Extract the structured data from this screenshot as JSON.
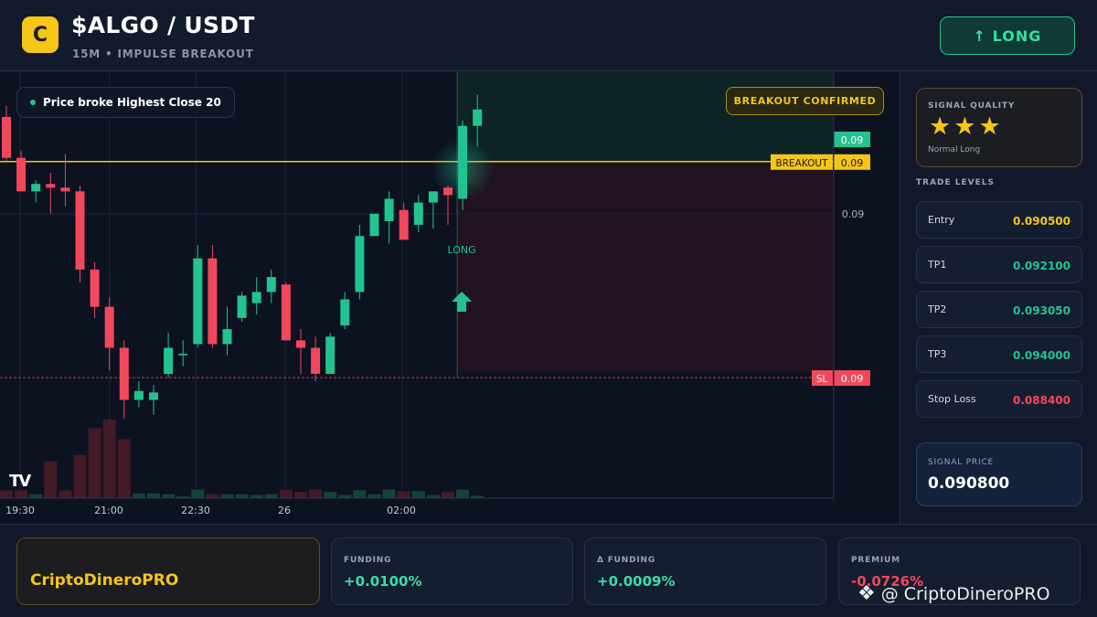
{
  "header": {
    "logo_letter": "C",
    "pair": "$ALGO / USDT",
    "subtitle": "15M • IMPULSE BREAKOUT",
    "signal_button": "↑ LONG"
  },
  "chart": {
    "pill_text": "Price broke Highest Close 20",
    "badge": "BREAKOUT CONFIRMED",
    "signal_label": "LONG",
    "tv_logo": "TV",
    "price_labels": {
      "current": "0.09",
      "breakout_name": "BREAKOUT",
      "breakout_value": "0.09",
      "axis": "0.09",
      "sl_name": "SL",
      "sl_value": "0.09"
    },
    "time_labels": [
      "19:30",
      "21:00",
      "22:30",
      "26",
      "02:00"
    ],
    "colors": {
      "up": "#23c38f",
      "down": "#f2485b",
      "breakout": "#f5c518"
    }
  },
  "chart_data": {
    "type": "candlestick",
    "x": [
      "19:30",
      "21:00",
      "22:30",
      "26",
      "02:00"
    ],
    "candles": [
      {
        "o": 0.0919,
        "h": 0.09205,
        "l": 0.0913,
        "c": 0.09135
      },
      {
        "o": 0.09135,
        "h": 0.09145,
        "l": 0.0909,
        "c": 0.0909
      },
      {
        "o": 0.0909,
        "h": 0.09105,
        "l": 0.09075,
        "c": 0.091
      },
      {
        "o": 0.091,
        "h": 0.09115,
        "l": 0.0906,
        "c": 0.09095
      },
      {
        "o": 0.09095,
        "h": 0.0914,
        "l": 0.0907,
        "c": 0.0909
      },
      {
        "o": 0.0909,
        "h": 0.09098,
        "l": 0.08968,
        "c": 0.08985
      },
      {
        "o": 0.08985,
        "h": 0.08995,
        "l": 0.0892,
        "c": 0.08935
      },
      {
        "o": 0.08935,
        "h": 0.08948,
        "l": 0.0885,
        "c": 0.0888
      },
      {
        "o": 0.0888,
        "h": 0.0889,
        "l": 0.08785,
        "c": 0.0881
      },
      {
        "o": 0.0881,
        "h": 0.08835,
        "l": 0.088,
        "c": 0.08822
      },
      {
        "o": 0.0881,
        "h": 0.0883,
        "l": 0.0879,
        "c": 0.0882
      },
      {
        "o": 0.08845,
        "h": 0.089,
        "l": 0.0884,
        "c": 0.0888
      },
      {
        "o": 0.0887,
        "h": 0.0889,
        "l": 0.08855,
        "c": 0.08872
      },
      {
        "o": 0.08885,
        "h": 0.09018,
        "l": 0.0888,
        "c": 0.09
      },
      {
        "o": 0.09,
        "h": 0.09018,
        "l": 0.0888,
        "c": 0.08885
      },
      {
        "o": 0.08885,
        "h": 0.08935,
        "l": 0.0887,
        "c": 0.08905
      },
      {
        "o": 0.0892,
        "h": 0.08955,
        "l": 0.08915,
        "c": 0.0895
      },
      {
        "o": 0.0894,
        "h": 0.08975,
        "l": 0.08925,
        "c": 0.08955
      },
      {
        "o": 0.08955,
        "h": 0.08985,
        "l": 0.0894,
        "c": 0.08975
      },
      {
        "o": 0.08965,
        "h": 0.08968,
        "l": 0.0889,
        "c": 0.0889
      },
      {
        "o": 0.0889,
        "h": 0.08905,
        "l": 0.08845,
        "c": 0.0888
      },
      {
        "o": 0.0888,
        "h": 0.08895,
        "l": 0.08835,
        "c": 0.08845
      },
      {
        "o": 0.08845,
        "h": 0.089,
        "l": 0.08845,
        "c": 0.08895
      },
      {
        "o": 0.0891,
        "h": 0.08955,
        "l": 0.08905,
        "c": 0.08945
      },
      {
        "o": 0.08955,
        "h": 0.09045,
        "l": 0.08945,
        "c": 0.0903
      },
      {
        "o": 0.0903,
        "h": 0.0906,
        "l": 0.0903,
        "c": 0.0906
      },
      {
        "o": 0.0905,
        "h": 0.0909,
        "l": 0.0902,
        "c": 0.0908
      },
      {
        "o": 0.09065,
        "h": 0.09075,
        "l": 0.09025,
        "c": 0.09025
      },
      {
        "o": 0.09045,
        "h": 0.09085,
        "l": 0.09035,
        "c": 0.09075
      },
      {
        "o": 0.09075,
        "h": 0.0909,
        "l": 0.0904,
        "c": 0.0909
      },
      {
        "o": 0.09095,
        "h": 0.09098,
        "l": 0.09045,
        "c": 0.09085
      },
      {
        "o": 0.0908,
        "h": 0.09185,
        "l": 0.09065,
        "c": 0.09178
      },
      {
        "o": 0.09178,
        "h": 0.0922,
        "l": 0.0915,
        "c": 0.092
      }
    ],
    "volume": [
      0.1,
      0.1,
      0.05,
      0.47,
      0.1,
      0.55,
      0.89,
      1.0,
      0.75,
      0.06,
      0.06,
      0.05,
      0.02,
      0.11,
      0.05,
      0.05,
      0.05,
      0.04,
      0.05,
      0.11,
      0.08,
      0.11,
      0.08,
      0.04,
      0.1,
      0.05,
      0.11,
      0.09,
      0.09,
      0.04,
      0.08,
      0.11,
      0.03
    ],
    "levels": {
      "breakout": 0.0913,
      "entry": 0.0905,
      "stop_loss": 0.0884
    },
    "signal_candle_index": 31,
    "ylim": [
      0.0871,
      0.0925
    ],
    "grid": true
  },
  "panel": {
    "quality_label": "SIGNAL QUALITY",
    "stars": "★★★",
    "quality_sub": "Normal Long",
    "trade_levels_title": "TRADE LEVELS",
    "levels": [
      {
        "name": "Entry",
        "value": "0.090500",
        "color": "#f5c518"
      },
      {
        "name": "TP1",
        "value": "0.092100",
        "color": "#23c38f"
      },
      {
        "name": "TP2",
        "value": "0.093050",
        "color": "#23c38f"
      },
      {
        "name": "TP3",
        "value": "0.094000",
        "color": "#23c38f"
      },
      {
        "name": "Stop Loss",
        "value": "0.088400",
        "color": "#f2485b"
      }
    ],
    "signal_price_label": "SIGNAL PRICE",
    "signal_price": "0.090800"
  },
  "footer": {
    "brand": "CriptoDineroPRO",
    "stats": [
      {
        "label": "FUNDING",
        "value": "+0.0100%",
        "color": "#35e0a5"
      },
      {
        "label": "Δ FUNDING",
        "value": "+0.0009%",
        "color": "#35e0a5"
      },
      {
        "label": "PREMIUM",
        "value": "-0.0726%",
        "color": "#f2485b"
      }
    ],
    "watermark": "@ CriptoDineroPRO",
    "watermark_icon": "binance-diamond-icon"
  }
}
